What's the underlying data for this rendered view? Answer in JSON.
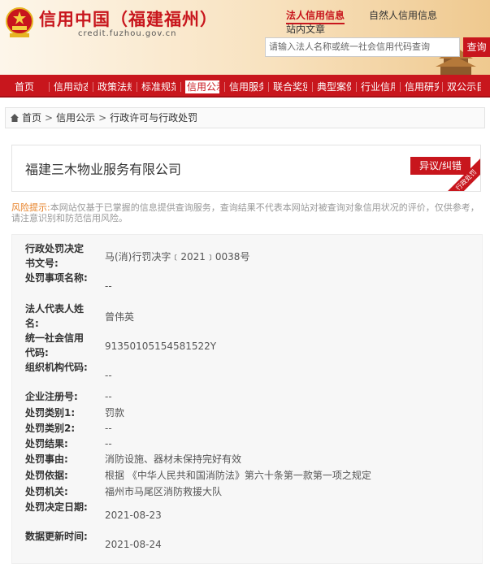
{
  "header": {
    "title": "信用中国（福建福州）",
    "domain": "credit.fuzhou.gov.cn",
    "nav_legal": "法人信用信息",
    "nav_natural": "自然人信用信息",
    "nav_articles": "站内文章",
    "search_placeholder": "请输入法人名称或统一社会信用代码查询",
    "search_button": "查询"
  },
  "mainnav": [
    "首页",
    "信用动态",
    "政策法规",
    "标准规范",
    "信用公示",
    "信用服务",
    "联合奖惩",
    "典型案例",
    "行业信用",
    "信用研究",
    "双公示目录"
  ],
  "mainnav_active_index": 4,
  "breadcrumb": [
    "首页",
    "信用公示",
    "行政许可与行政处罚"
  ],
  "company": {
    "name": "福建三木物业服务有限公司",
    "dispute_button": "异议/纠错",
    "corner_tag": "行政处罚"
  },
  "risk": {
    "label": "风险提示:",
    "text": "本网站仅基于已掌握的信息提供查询服务，查询结果不代表本网站对被查询对象信用状况的评价，仅供参考，请注意识别和防范信用风险。"
  },
  "details": [
    {
      "label": "行政处罚决定书文号:",
      "value": "马(消)行罚决字﹝2021﹞0038号"
    },
    {
      "label": "处罚事项名称:",
      "value": "--"
    },
    {
      "label": "法人代表人姓名:",
      "value": "曾伟英"
    },
    {
      "label": "统一社会信用代码:",
      "value": "91350105154581522Y"
    },
    {
      "label": "组织机构代码:",
      "value": "--"
    },
    {
      "label": "企业注册号:",
      "value": "--"
    },
    {
      "label": "处罚类别1:",
      "value": "罚款"
    },
    {
      "label": "处罚类别2:",
      "value": "--"
    },
    {
      "label": "处罚结果:",
      "value": "--"
    },
    {
      "label": "处罚事由:",
      "value": "消防设施、器材未保持完好有效"
    },
    {
      "label": "处罚依据:",
      "value": "根据 《中华人民共和国消防法》第六十条第一款第一项之规定"
    },
    {
      "label": "处罚机关:",
      "value": "福州市马尾区消防救援大队"
    },
    {
      "label": "处罚决定日期:",
      "value": "2021-08-23"
    },
    {
      "label": "数据更新时间:",
      "value": "2021-08-24"
    }
  ]
}
